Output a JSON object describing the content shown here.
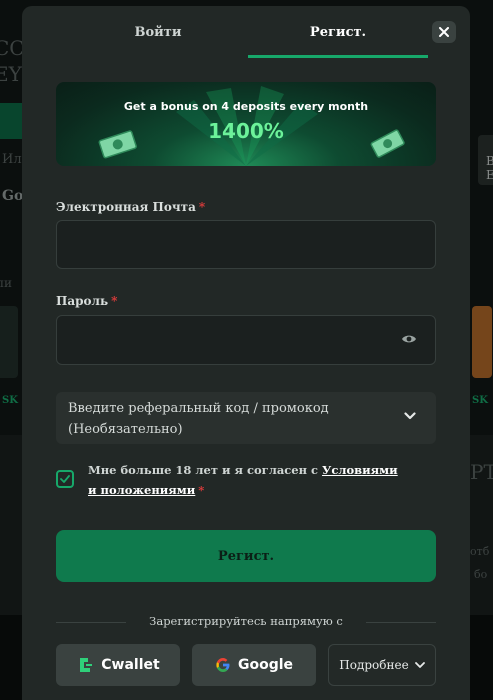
{
  "background": {
    "left_fragments": [
      "CC",
      "EY",
      "Ил",
      "Go",
      "пи",
      "SK"
    ],
    "right_fragments": [
      "B",
      "E",
      "PT",
      "отб",
      "бо",
      "SK"
    ]
  },
  "tabs": {
    "login": "Войти",
    "register": "Регист."
  },
  "close_icon": "close-icon",
  "banner": {
    "title": "Get a bonus on 4 deposits every month",
    "amount": "1400%"
  },
  "form": {
    "email_label": "Электронная Почта",
    "email_value": "",
    "password_label": "Пароль",
    "password_value": "",
    "required_mark": "*",
    "promo_placeholder": "Введите реферальный код / промокод (Необязательно)",
    "checkbox_checked": true,
    "terms_text": "Мне больше 18 лет и я согласен с ",
    "terms_link": "Условиями и положениями",
    "submit_label": "Регист."
  },
  "social": {
    "divider_text": "Зарегистрируйтесь напрямую с",
    "cwallet": "Cwallet",
    "google": "Google",
    "more": "Подробнее"
  },
  "colors": {
    "accent": "#17a86a",
    "modal_bg": "#222826",
    "submit_bg": "#0f7a4d",
    "banner_amount": "#6cf29a"
  }
}
